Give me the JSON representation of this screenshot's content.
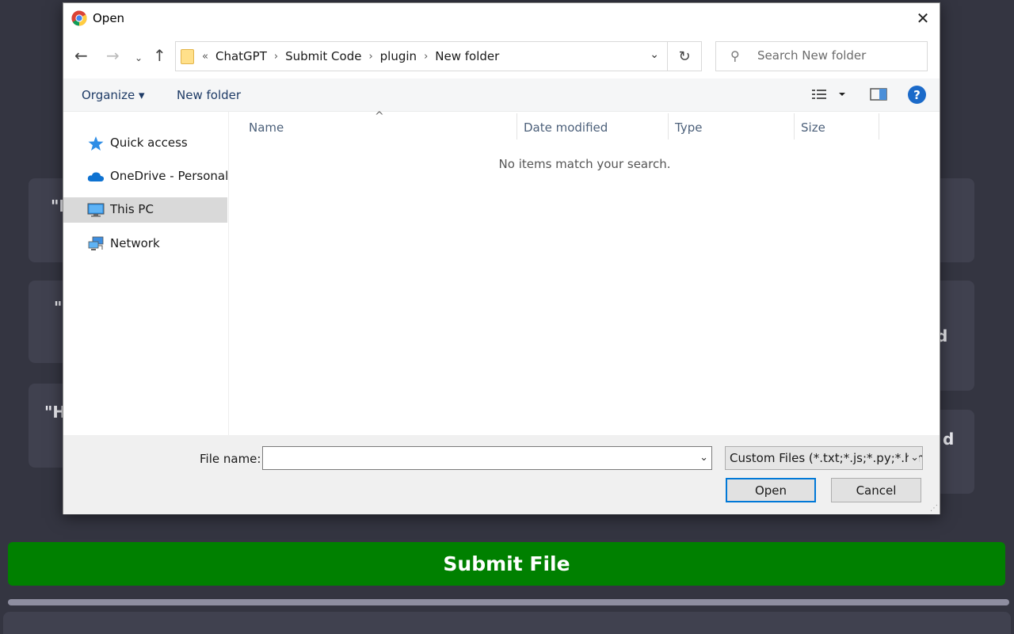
{
  "background": {
    "fragments": [
      "\"I",
      "\"",
      "\"H",
      "d",
      "d"
    ],
    "submit_label": "Submit File"
  },
  "dialog": {
    "title": "Open",
    "breadcrumb": [
      "«",
      "ChatGPT",
      "Submit Code",
      "plugin",
      "New folder"
    ],
    "search_placeholder": "Search New folder",
    "toolbar": {
      "organize": "Organize ▾",
      "new_folder": "New folder"
    },
    "sidebar": [
      {
        "label": "Quick access",
        "icon": "star-icon"
      },
      {
        "label": "OneDrive - Personal",
        "icon": "cloud-icon"
      },
      {
        "label": "This PC",
        "icon": "computer-icon",
        "selected": true
      },
      {
        "label": "Network",
        "icon": "network-icon"
      }
    ],
    "columns": [
      "Name",
      "Date modified",
      "Type",
      "Size"
    ],
    "empty_message": "No items match your search.",
    "file_name_label": "File name:",
    "file_name_value": "",
    "filter_label": "Custom Files (*.txt;*.js;*.py;*.html;*.css)",
    "open_label": "Open",
    "cancel_label": "Cancel"
  },
  "colors": {
    "page_bg": "#343541",
    "card_bg": "#40414f",
    "submit_green": "#008000",
    "accent_blue": "#0078d7"
  }
}
